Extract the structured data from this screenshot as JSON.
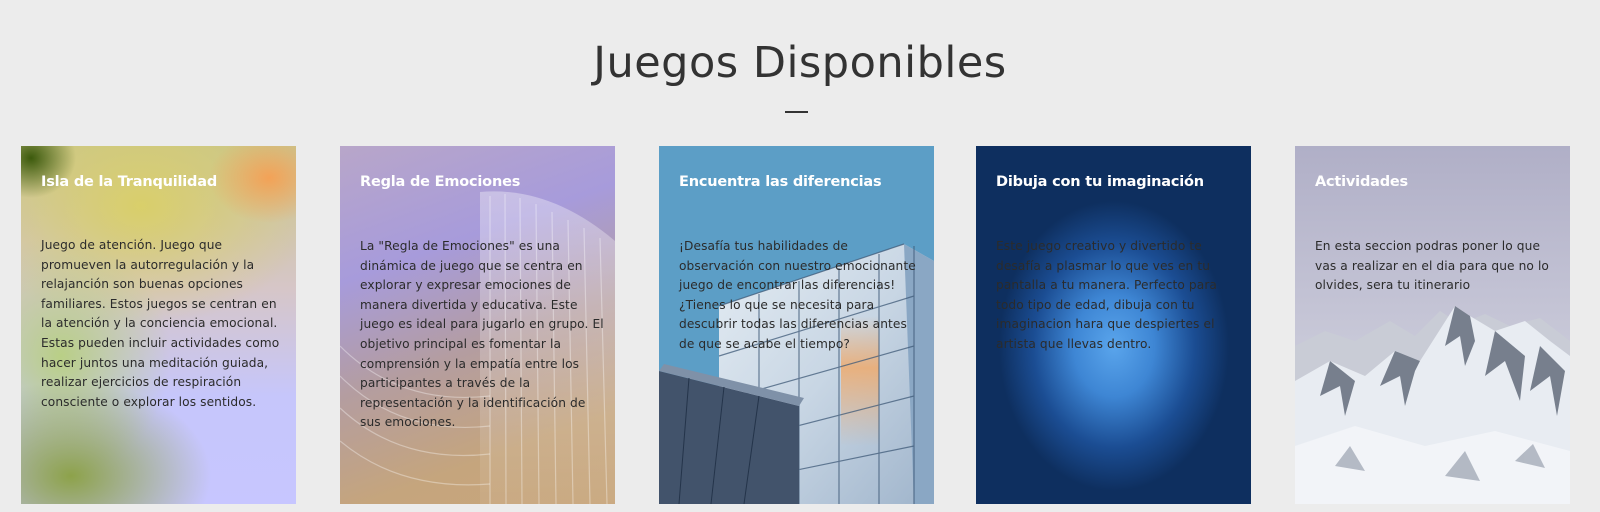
{
  "section": {
    "title": "Juegos Disponibles"
  },
  "cards": [
    {
      "title": "Isla de la Tranquilidad",
      "description": "Juego de atención. Juego que promueven la autorregulación y la relajanción son buenas opciones familiares. Estos juegos se centran en la atención y la conciencia emocional. Estas pueden incluir actividades como hacer juntos una meditación guiada, realizar ejercicios de respiración consciente o explorar los sentidos.",
      "background": "gradient-mesh"
    },
    {
      "title": "Regla de Emociones",
      "description": "La \"Regla de Emociones\" es una dinámica de juego que se centra en explorar y expresar emociones de manera divertida y educativa. Este juego es ideal para jugarlo en grupo. El objetivo principal es fomentar la comprensión y la empatía entre los participantes a través de la representación y la identificación de sus emociones.",
      "background": "architecture-ribs"
    },
    {
      "title": "Encuentra las diferencias",
      "description": "¡Desafía tus habilidades de observación con nuestro emocionante juego de encontrar las diferencias! ¿Tienes lo que se necesita para descubrir todas las diferencias antes de que se acabe el tiempo?",
      "background": "glass-building"
    },
    {
      "title": "Dibuja con tu imaginación",
      "description": "Este juego creativo y divertido te desafía a plasmar lo que ves en tu pantalla a tu manera. Perfecto para todo tipo de edad, dibuja con tu imaginacion hara que despiertes el artista que llevas dentro.",
      "background": "blue-glow"
    },
    {
      "title": "Actividades",
      "description": "En esta seccion podras poner lo que vas a realizar en el dia para que no lo olvides, sera tu itinerario",
      "background": "snowy-mountains"
    }
  ]
}
